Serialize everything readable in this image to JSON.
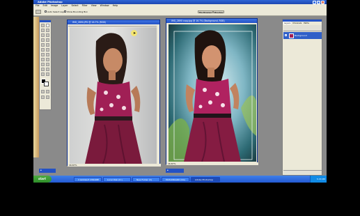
{
  "app": {
    "title": "Adobe Photoshop"
  },
  "menu": [
    "File",
    "Edit",
    "Image",
    "Layer",
    "Select",
    "Filter",
    "View",
    "Window",
    "Help"
  ],
  "options": {
    "auto_select": "Auto Select Layer",
    "bounding_box": "Show Bounding Box"
  },
  "top_tabs": {
    "file_browser": "File Browser",
    "brushes": "Brushes"
  },
  "doc_left": {
    "title": "IMG_2890.JPG @ 16.7% (RGB)",
    "zoom": "16.67%"
  },
  "doc_right": {
    "title": "IMG_2890 copy.jpg @ 16.7% (Background, RGB)",
    "zoom": "16.67%"
  },
  "layers_panel": {
    "tabs": [
      "Layers",
      "Channels",
      "Paths"
    ],
    "layer_name": "Background"
  },
  "taskbar": {
    "start": "start",
    "tasks": [
      "3 GOOGLE CHROME",
      "Local Disk (D:)",
      "New Folder (3)",
      "MUSICBOARD (DA)",
      "Adobe Photoshop"
    ],
    "clock": "5:33 PM"
  },
  "colors": {
    "titlebar": "#2452c4",
    "taskbar": "#245ad4",
    "start": "#2f8f2a",
    "dress": "#a01f55"
  }
}
